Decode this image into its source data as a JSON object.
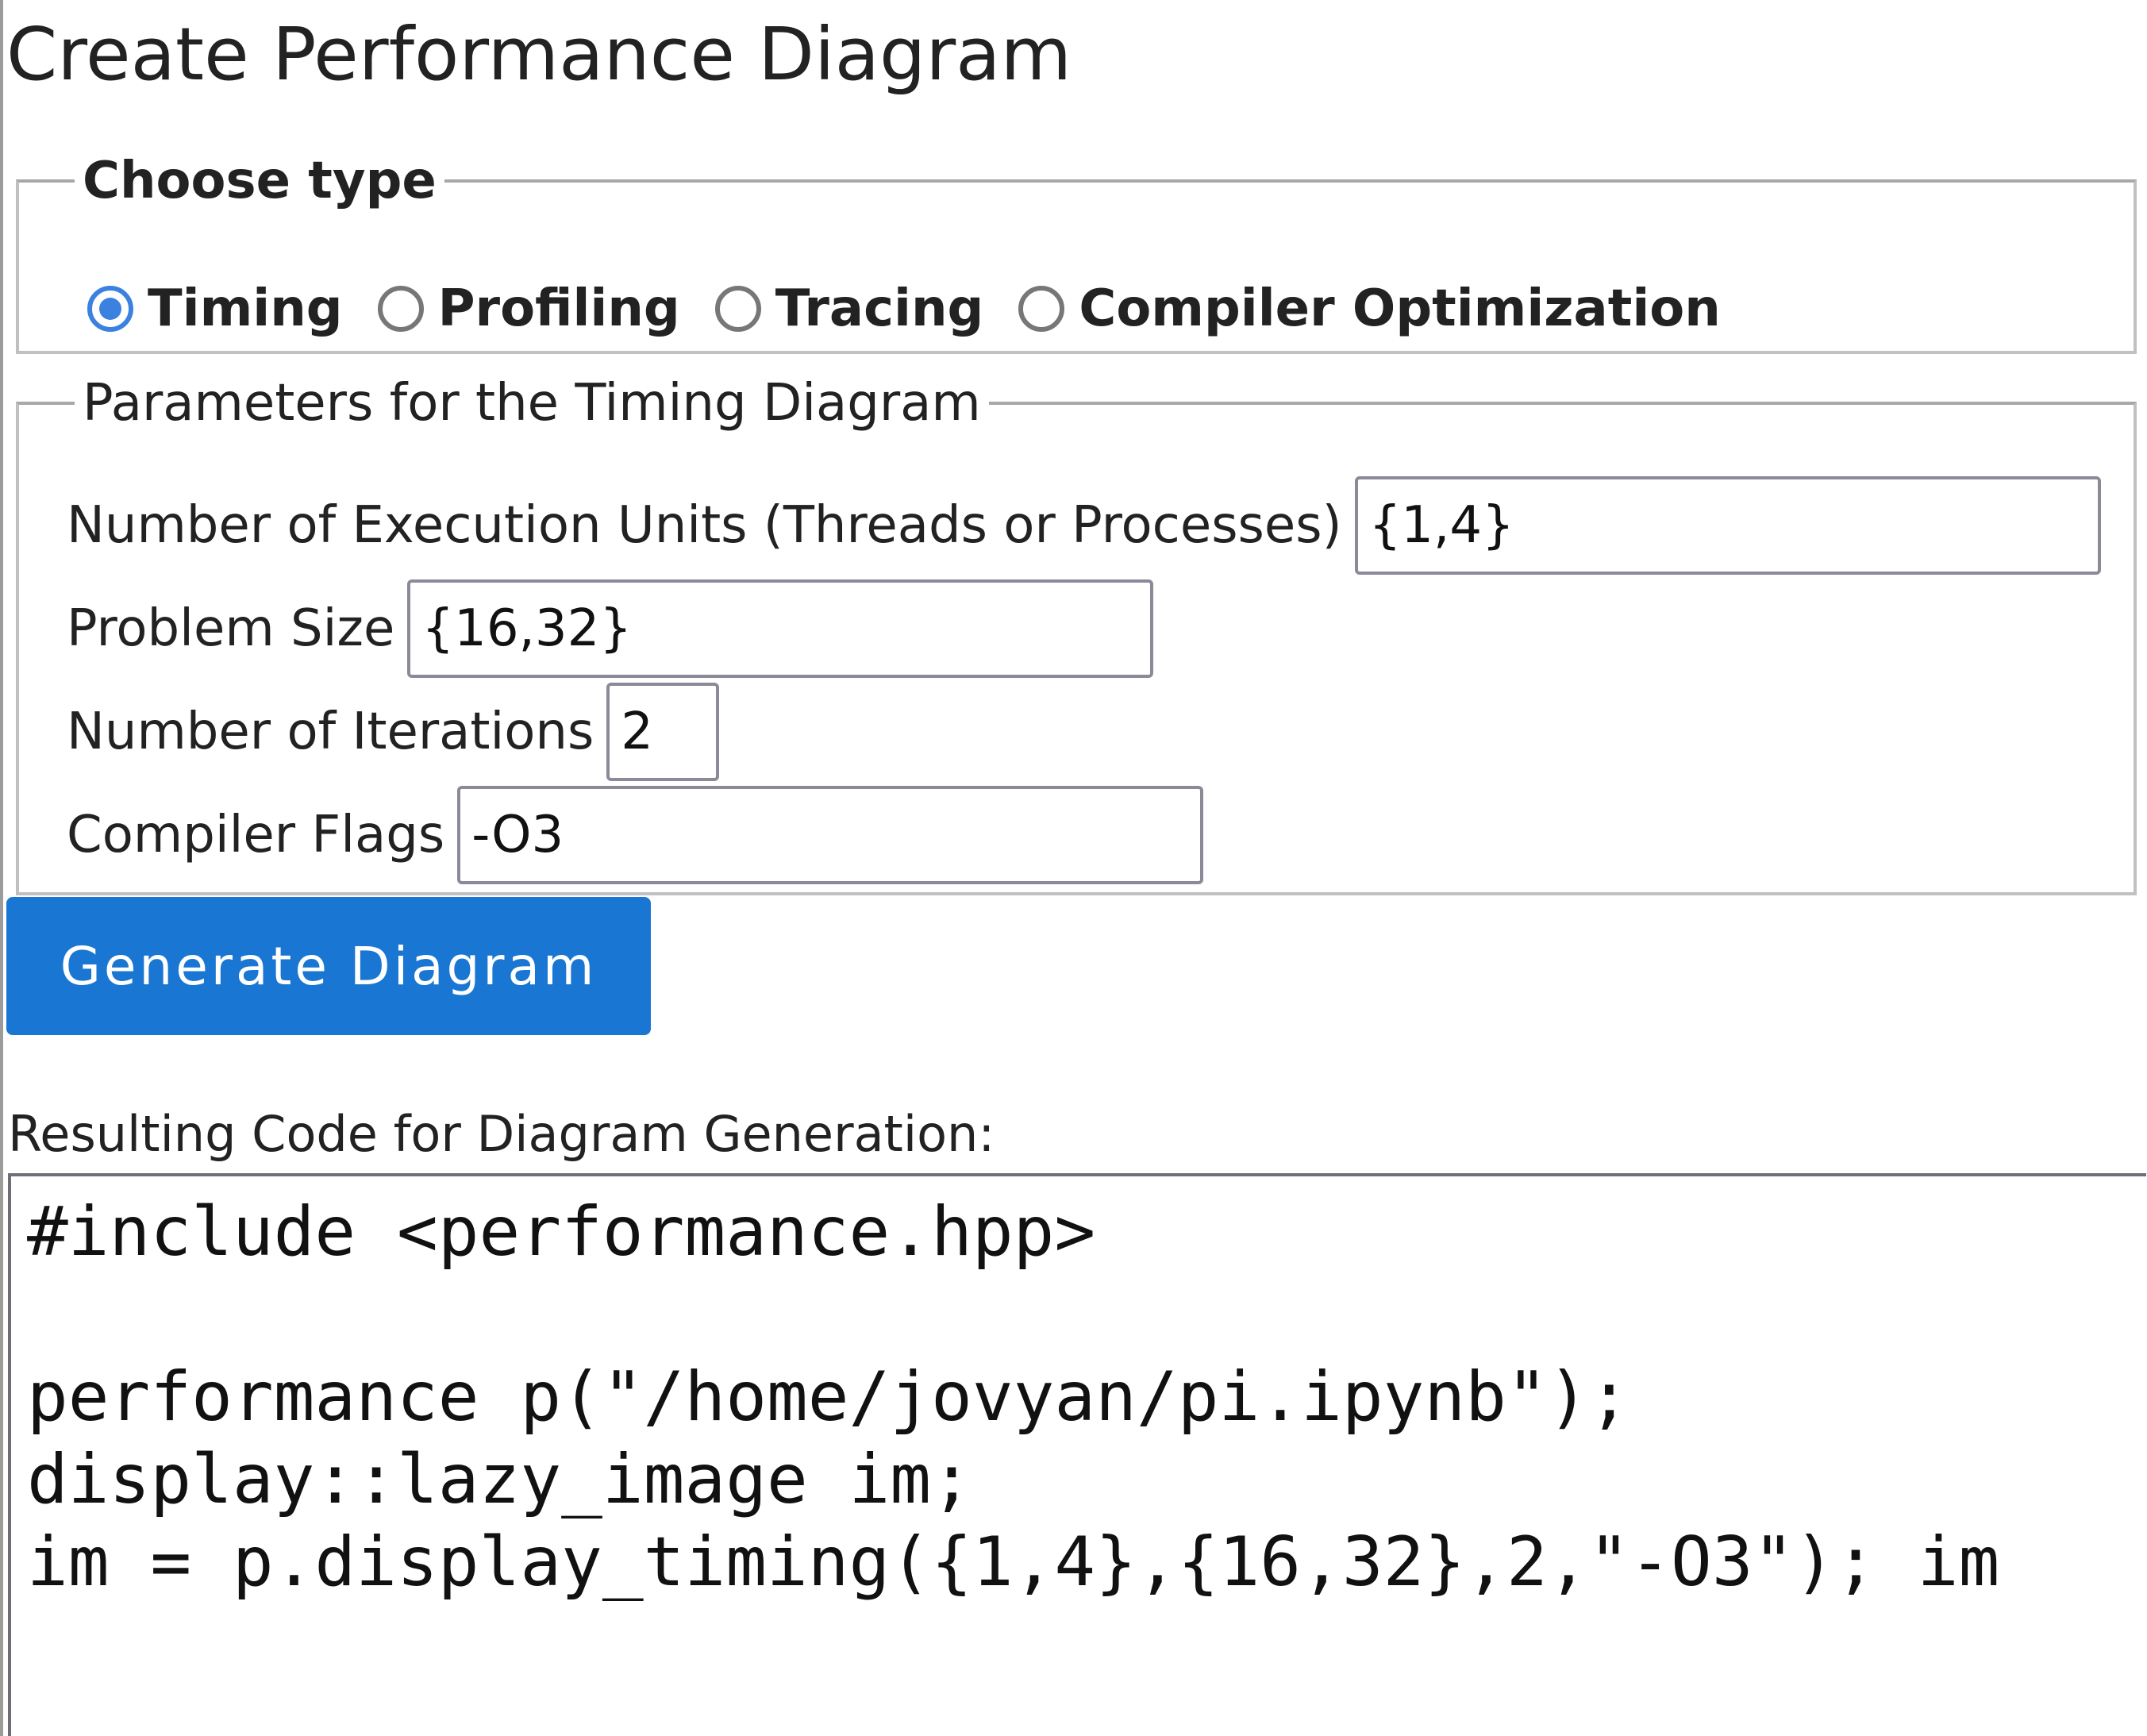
{
  "title": "Create Performance Diagram",
  "type_section": {
    "legend": "Choose type",
    "selected": "Timing",
    "options": [
      {
        "label": "Timing",
        "checked": true
      },
      {
        "label": "Profiling",
        "checked": false
      },
      {
        "label": "Tracing",
        "checked": false
      },
      {
        "label": "Compiler Optimization",
        "checked": false
      }
    ]
  },
  "params_section": {
    "legend": "Parameters for the Timing Diagram",
    "execution_units": {
      "label": "Number of Execution Units (Threads or Processes)",
      "value": "{1,4}"
    },
    "problem_size": {
      "label": "Problem Size",
      "value": "{16,32}"
    },
    "iterations": {
      "label": "Number of Iterations",
      "value": "2"
    },
    "compiler_flags": {
      "label": "Compiler Flags",
      "value": "-O3"
    }
  },
  "generate_button": {
    "label": "Generate Diagram"
  },
  "result": {
    "label": "Resulting Code for Diagram Generation:",
    "code": "#include <performance.hpp>\n\nperformance p(\"/home/jovyan/pi.ipynb\");\ndisplay::lazy_image im;\nim = p.display_timing({1,4},{16,32},2,\"-O3\"); im"
  },
  "colors": {
    "accent": "#1976d2",
    "radio_checked": "#3b82e0",
    "border": "#c0c0c0"
  }
}
